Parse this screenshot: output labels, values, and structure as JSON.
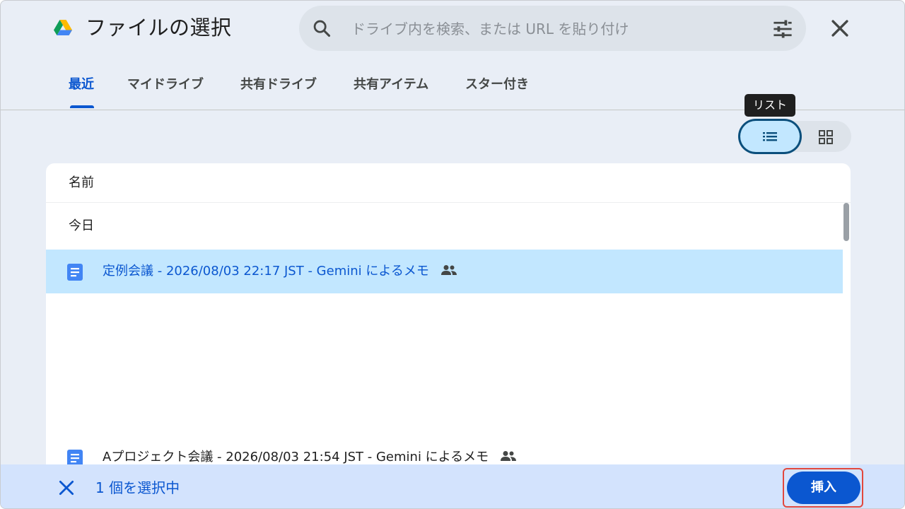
{
  "dialog": {
    "title": "ファイルの選択"
  },
  "search": {
    "placeholder": "ドライブ内を検索、または URL を貼り付け"
  },
  "tabs": [
    {
      "label": "最近",
      "active": true
    },
    {
      "label": "マイドライブ",
      "active": false
    },
    {
      "label": "共有ドライブ",
      "active": false
    },
    {
      "label": "共有アイテム",
      "active": false
    },
    {
      "label": "スター付き",
      "active": false
    }
  ],
  "view": {
    "tooltip": "リスト",
    "selected": "list"
  },
  "list": {
    "column_name": "名前",
    "section": "今日",
    "files": [
      {
        "name": "定例会議 - 2026/08/03 22:17 JST - Gemini によるメモ",
        "selected": true,
        "icon": "docs-icon",
        "shared": true
      },
      {
        "name": "Aプロジェクト会議 - 2026/08/03 21:54 JST - Gemini によるメモ",
        "selected": false,
        "icon": "docs-icon",
        "shared": true
      }
    ]
  },
  "footer": {
    "selection_count": "1 個を選択中",
    "insert_label": "挿入"
  },
  "colors": {
    "accent": "#0b57d0",
    "selected_row": "#c2e7ff",
    "background": "#e9eef6",
    "action_bar": "#d3e3fd",
    "highlight_outline": "#e2483d",
    "docs_blue": "#4285f4"
  }
}
